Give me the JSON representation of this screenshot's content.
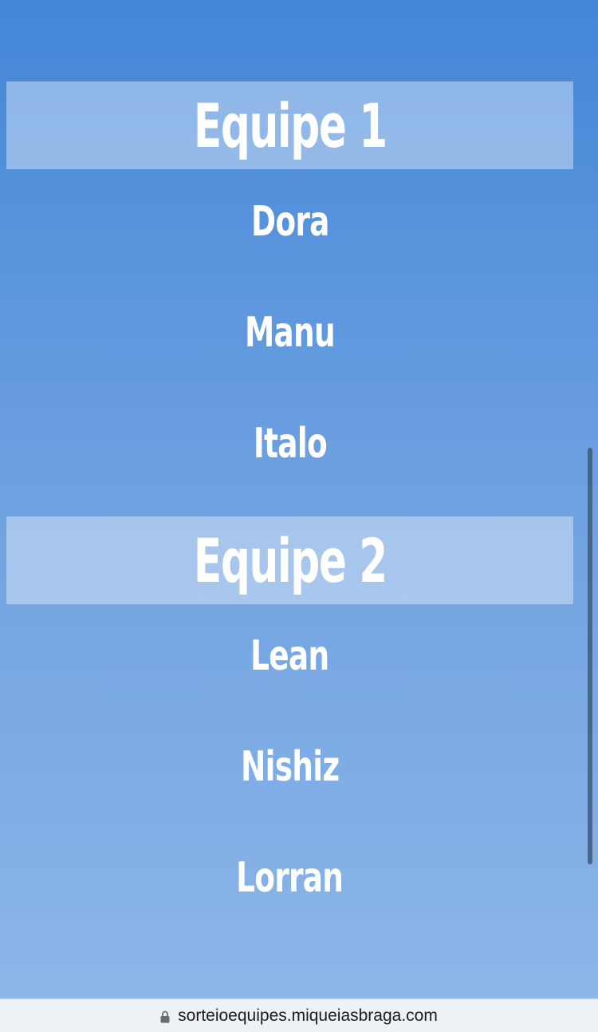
{
  "teams": [
    {
      "header": "Equipe 1",
      "members": [
        "Dora",
        "Manu",
        "Italo"
      ]
    },
    {
      "header": "Equipe 2",
      "members": [
        "Lean",
        "Nishiz",
        "Lorran"
      ]
    }
  ],
  "browser": {
    "url": "sorteioequipes.miqueiasbraga.com",
    "lock_icon": "lock-icon"
  },
  "colors": {
    "background_top": "#4286d7",
    "background_bottom": "#8db6e8",
    "text": "#ffffff"
  }
}
